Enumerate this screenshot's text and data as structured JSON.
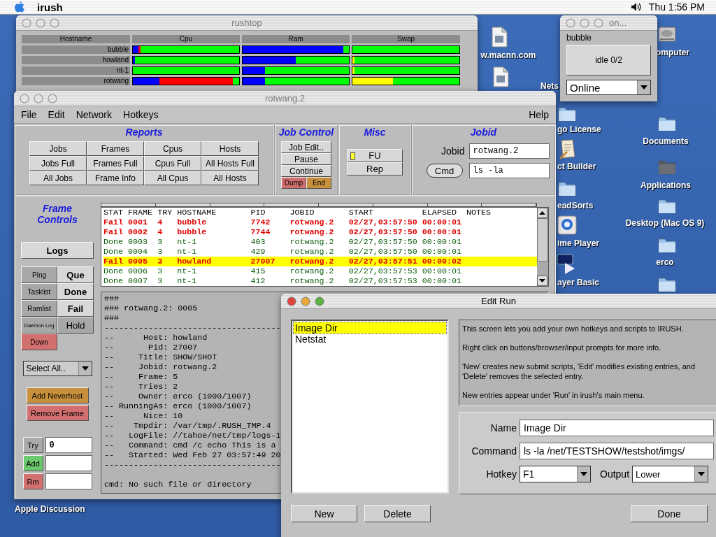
{
  "menu_bar": {
    "app_name": "irush",
    "clock": "Thu 1:56 PM"
  },
  "desktop_icons": [
    {
      "kind": "document",
      "label": "w.macnn.com"
    },
    {
      "kind": "document"
    },
    {
      "kind": "none",
      "label": "Nets"
    },
    {
      "kind": "folder",
      "label": "go License"
    },
    {
      "kind": "builder",
      "label": "ct Builder"
    },
    {
      "kind": "folder",
      "label": "eadSorts"
    },
    {
      "kind": "quicktime",
      "label": "ime Player"
    },
    {
      "kind": "real",
      "label": "ayer Basic"
    },
    {
      "kind": "disk",
      "label": "omputer"
    },
    {
      "kind": "folder",
      "label": "Documents"
    },
    {
      "kind": "folder-dark",
      "label": "Applications"
    },
    {
      "kind": "folder",
      "label": "Desktop (Mac OS 9)"
    },
    {
      "kind": "folder",
      "label": "erco"
    },
    {
      "kind": "folder"
    },
    {
      "kind": "none",
      "label": "Apple Discussion"
    }
  ],
  "rushtop": {
    "title": "rushtop",
    "active": false,
    "columns": [
      "Hostname",
      "Cpu",
      "Ram",
      "Swap"
    ],
    "hosts": [
      {
        "name": "bubble",
        "cpu": [
          {
            "color": "#0000ff",
            "level": 0.05
          },
          {
            "color": "#ff0000",
            "level": 0.07
          }
        ],
        "ram": [
          {
            "color": "#0000ff",
            "level": 0.95
          }
        ]
      },
      {
        "name": "howland",
        "cpu": [
          {
            "color": "#0000ff",
            "level": 0.02
          }
        ],
        "ram": [
          {
            "color": "#0000ff",
            "level": 0.5
          }
        ],
        "swap": [
          {
            "color": "#ffff00",
            "level": 0.02
          }
        ]
      },
      {
        "name": "nt-1",
        "ram": [
          {
            "color": "#0000ff",
            "level": 0.21
          }
        ],
        "swap": [
          {
            "color": "#ffff00",
            "level": 0.02
          }
        ]
      },
      {
        "name": "rotwang",
        "cpu": [
          {
            "color": "#0000ff",
            "level": 0.25
          },
          {
            "color": "#ff0000",
            "level": 0.94
          }
        ],
        "ram": [
          {
            "color": "#0000ff",
            "level": 0.21
          }
        ],
        "swap": [
          {
            "color": "#ffff00",
            "level": 0.38
          }
        ]
      }
    ]
  },
  "status_window": {
    "title": "on...",
    "active": false,
    "host": "bubble",
    "state_button": "idle 0/2",
    "mode": "Online"
  },
  "main_window": {
    "title": "rotwang.2",
    "active": false,
    "menu": [
      "File",
      "Edit",
      "Network",
      "Hotkeys"
    ],
    "help_menu": "Help",
    "reports": {
      "title": "Reports",
      "buttons": [
        "Jobs",
        "Frames",
        "Cpus",
        "Hosts",
        "Jobs Full",
        "Frames Full",
        "Cpus Full",
        "All Hosts Full",
        "All Jobs",
        "Frame Info",
        "All Cpus",
        "All Hosts"
      ]
    },
    "job_control": {
      "title": "Job Control",
      "buttons": [
        {
          "label": "Job Edit..",
          "kind": "plain"
        },
        {
          "label": "Pause",
          "kind": "plain"
        },
        {
          "label": "Continue",
          "kind": "plain"
        },
        {
          "label": "Dump",
          "kind": "red"
        },
        {
          "label": "End",
          "kind": "orange"
        }
      ]
    },
    "misc": {
      "title": "Misc",
      "buttons": [
        {
          "label": "FU",
          "kind": "toggle",
          "on": true
        },
        {
          "label": "Rep",
          "kind": "plain"
        }
      ]
    },
    "jobid": {
      "title": "Jobid",
      "jobid_label": "Jobid",
      "jobid_value": "rotwang.2",
      "cmd_button": "Cmd",
      "cmd_value": "ls -la"
    },
    "frame_controls": {
      "title": "Frame Controls",
      "logs_button": "Logs",
      "buttons": [
        {
          "label": "Ping",
          "kind": "small"
        },
        {
          "label": "Que",
          "kind": "bold"
        },
        {
          "label": "Tasklist",
          "kind": "small"
        },
        {
          "label": "Done",
          "kind": "bold"
        },
        {
          "label": "Ramlist",
          "kind": "small"
        },
        {
          "label": "Fail",
          "kind": "bold"
        },
        {
          "label": "Daemon Log",
          "kind": "tiny"
        },
        {
          "label": "Hold",
          "kind": "large"
        },
        {
          "label": "Down",
          "kind": "red"
        }
      ],
      "select": "Select All..",
      "action_buttons": [
        {
          "label": "Add Neverhost",
          "kind": "orange"
        },
        {
          "label": "Remove Frame",
          "kind": "red"
        }
      ],
      "inputs": [
        {
          "button": "Try",
          "kind": "grey",
          "value": "0"
        },
        {
          "button": "Add",
          "kind": "green"
        },
        {
          "button": "Rm",
          "kind": "red"
        }
      ]
    },
    "frames": {
      "columns": [
        "STAT",
        "FRAME",
        "TRY",
        "HOSTNAME",
        "PID",
        "JOBID",
        "START",
        "ELAPSED",
        "NOTES"
      ],
      "rows": [
        {
          "kind": "fail",
          "selected": false,
          "cells": [
            "Fail",
            "0001",
            "4",
            "bubble",
            "7742",
            "rotwang.2",
            "02/27,03:57:50",
            "00:00:01"
          ]
        },
        {
          "kind": "fail",
          "selected": false,
          "cells": [
            "Fail",
            "0002",
            "4",
            "bubble",
            "7744",
            "rotwang.2",
            "02/27,03:57:50",
            "00:00:01"
          ]
        },
        {
          "kind": "done",
          "selected": false,
          "cells": [
            "Done",
            "0003",
            "3",
            "nt-1",
            "403",
            "rotwang.2",
            "02/27,03:57:50",
            "00:00:01"
          ]
        },
        {
          "kind": "done",
          "selected": false,
          "cells": [
            "Done",
            "0004",
            "3",
            "nt-1",
            "429",
            "rotwang.2",
            "02/27,03:57:50",
            "00:00:01"
          ]
        },
        {
          "kind": "fail",
          "selected": true,
          "cells": [
            "Fail",
            "0005",
            "3",
            "howland",
            "27007",
            "rotwang.2",
            "02/27,03:57:51",
            "00:00:02"
          ]
        },
        {
          "kind": "done",
          "selected": false,
          "cells": [
            "Done",
            "0006",
            "3",
            "nt-1",
            "415",
            "rotwang.2",
            "02/27,03:57:53",
            "00:00:01"
          ]
        },
        {
          "kind": "done",
          "selected": false,
          "cells": [
            "Done",
            "0007",
            "3",
            "nt-1",
            "412",
            "rotwang.2",
            "02/27,03:57:53",
            "00:00:01"
          ]
        }
      ]
    },
    "log": {
      "lines": [
        "###",
        "### rotwang.2: 0005",
        "###",
        "------------------------------------",
        "--      Host: howland",
        "--       Pid: 27007",
        "--     Title: SHOW/SHOT",
        "--     Jobid: rotwang.2",
        "--     Frame: 5",
        "--     Tries: 2",
        "--     Owner: erco (1000/1007)",
        "-- RunningAs: erco (1000/1007)",
        "--      Nice: 10",
        "--    Tmpdir: /var/tmp/.RUSH_TMP.4",
        "--   LogFile: //tahoe/net/tmp/logs-1",
        "--   Command: cmd /c echo This is a",
        "--   Started: Wed Feb 27 03:57:49 20",
        "------------------------------------"
      ],
      "message": "cmd: No such file or directory"
    }
  },
  "edit_run": {
    "title": "Edit Run",
    "active": true,
    "entries": [
      {
        "label": "Image Dir",
        "selected": true
      },
      {
        "label": "Netstat",
        "selected": false
      }
    ],
    "info": [
      "This screen lets you add your own hotkeys and scripts to IRUSH.",
      "Right click on buttons/browser/input prompts for more info.",
      "'New' creates new submit scripts, 'Edit' modifies existing entries, and 'Delete' removes the selected entry.",
      "New entries appear under 'Run' in irush's main menu."
    ],
    "name_label": "Name",
    "name_value": "Image Dir",
    "command_label": "Command",
    "command_value": "ls -la /net/TESTSHOW/testshot/imgs/",
    "hotkey_label": "Hotkey",
    "hotkey_value": "F1",
    "output_label": "Output",
    "output_value": "Lower",
    "buttons": [
      "New",
      "Delete"
    ],
    "done_button": "Done"
  }
}
